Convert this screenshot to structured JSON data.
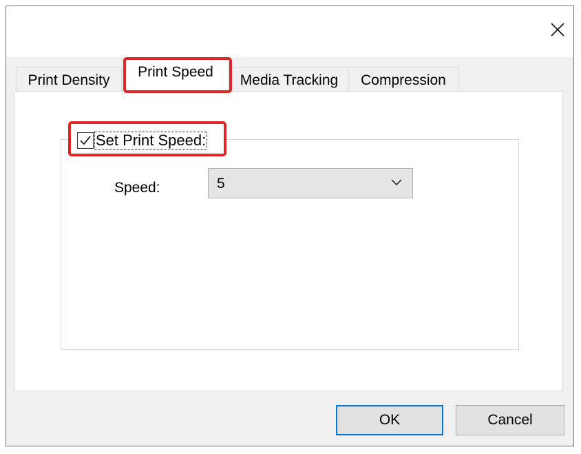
{
  "dialog": {
    "close_glyph": "close-icon"
  },
  "tabs": [
    {
      "label": "Print Density",
      "active": false
    },
    {
      "label": "Print Speed",
      "active": true
    },
    {
      "label": "Media Tracking",
      "active": false
    },
    {
      "label": "Compression",
      "active": false
    }
  ],
  "panel": {
    "set_speed_label": "Set Print Speed:",
    "set_speed_checked": true,
    "speed_label": "Speed:",
    "speed_value": "5"
  },
  "buttons": {
    "ok_label": "OK",
    "cancel_label": "Cancel"
  },
  "colors": {
    "highlight": "#e02626",
    "focus_border": "#0078d7",
    "dialog_bg": "#f0f0f0"
  }
}
